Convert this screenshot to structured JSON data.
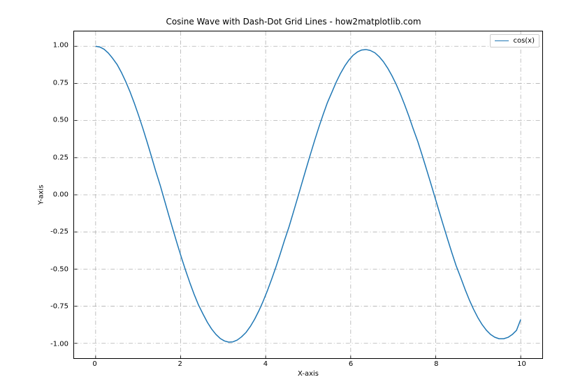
{
  "chart_data": {
    "type": "line",
    "title": "Cosine Wave with Dash-Dot Grid Lines - how2matplotlib.com",
    "xlabel": "X-axis",
    "ylabel": "Y-axis",
    "xlim": [
      -0.5,
      10.5
    ],
    "ylim": [
      -1.1,
      1.1
    ],
    "xticks": [
      0,
      2,
      4,
      6,
      8,
      10
    ],
    "yticks": [
      -1.0,
      -0.75,
      -0.5,
      -0.25,
      0.0,
      0.25,
      0.5,
      0.75,
      1.0
    ],
    "xtick_labels": [
      "0",
      "2",
      "4",
      "6",
      "8",
      "10"
    ],
    "ytick_labels": [
      "-1.00",
      "-0.75",
      "-0.50",
      "-0.25",
      "0.00",
      "0.25",
      "0.50",
      "0.75",
      "1.00"
    ],
    "grid": {
      "style": "dash-dot",
      "color": "#b0b0b0",
      "width": 0.8
    },
    "series": [
      {
        "name": "cos(x)",
        "color": "#1f77b4",
        "x": [
          0.0,
          0.1,
          0.2,
          0.3,
          0.4,
          0.51,
          0.61,
          0.71,
          0.81,
          0.91,
          1.01,
          1.11,
          1.21,
          1.31,
          1.41,
          1.52,
          1.62,
          1.72,
          1.82,
          1.92,
          2.02,
          2.12,
          2.22,
          2.32,
          2.42,
          2.53,
          2.63,
          2.73,
          2.83,
          2.93,
          3.03,
          3.13,
          3.23,
          3.33,
          3.43,
          3.54,
          3.64,
          3.74,
          3.84,
          3.94,
          4.04,
          4.14,
          4.24,
          4.34,
          4.44,
          4.55,
          4.65,
          4.75,
          4.85,
          4.95,
          5.05,
          5.15,
          5.25,
          5.35,
          5.45,
          5.56,
          5.66,
          5.76,
          5.86,
          5.96,
          6.06,
          6.16,
          6.26,
          6.36,
          6.46,
          6.57,
          6.67,
          6.77,
          6.87,
          6.97,
          7.07,
          7.17,
          7.27,
          7.37,
          7.47,
          7.58,
          7.68,
          7.78,
          7.88,
          7.98,
          8.08,
          8.18,
          8.28,
          8.38,
          8.48,
          8.59,
          8.69,
          8.79,
          8.89,
          8.99,
          9.09,
          9.19,
          9.29,
          9.39,
          9.49,
          9.6,
          9.7,
          9.8,
          9.9,
          10.0
        ],
        "values": [
          1.0,
          0.995,
          0.98,
          0.954,
          0.919,
          0.875,
          0.822,
          0.761,
          0.693,
          0.617,
          0.535,
          0.448,
          0.356,
          0.261,
          0.163,
          0.063,
          -0.037,
          -0.137,
          -0.235,
          -0.331,
          -0.424,
          -0.512,
          -0.595,
          -0.672,
          -0.742,
          -0.805,
          -0.859,
          -0.904,
          -0.94,
          -0.967,
          -0.984,
          -0.992,
          -0.99,
          -0.978,
          -0.957,
          -0.926,
          -0.886,
          -0.838,
          -0.781,
          -0.717,
          -0.646,
          -0.569,
          -0.487,
          -0.4,
          -0.309,
          -0.215,
          -0.119,
          -0.022,
          0.076,
          0.174,
          0.27,
          0.364,
          0.454,
          0.539,
          0.619,
          0.692,
          0.759,
          0.817,
          0.867,
          0.908,
          0.94,
          0.962,
          0.975,
          0.978,
          0.972,
          0.956,
          0.93,
          0.896,
          0.853,
          0.802,
          0.744,
          0.678,
          0.606,
          0.528,
          0.445,
          0.358,
          0.268,
          0.175,
          0.081,
          -0.015,
          -0.111,
          -0.206,
          -0.299,
          -0.39,
          -0.477,
          -0.559,
          -0.636,
          -0.707,
          -0.77,
          -0.826,
          -0.873,
          -0.911,
          -0.94,
          -0.959,
          -0.969,
          -0.969,
          -0.96,
          -0.941,
          -0.913,
          -0.839
        ]
      }
    ],
    "legend": {
      "position": "upper right",
      "entries": [
        "cos(x)"
      ]
    }
  }
}
